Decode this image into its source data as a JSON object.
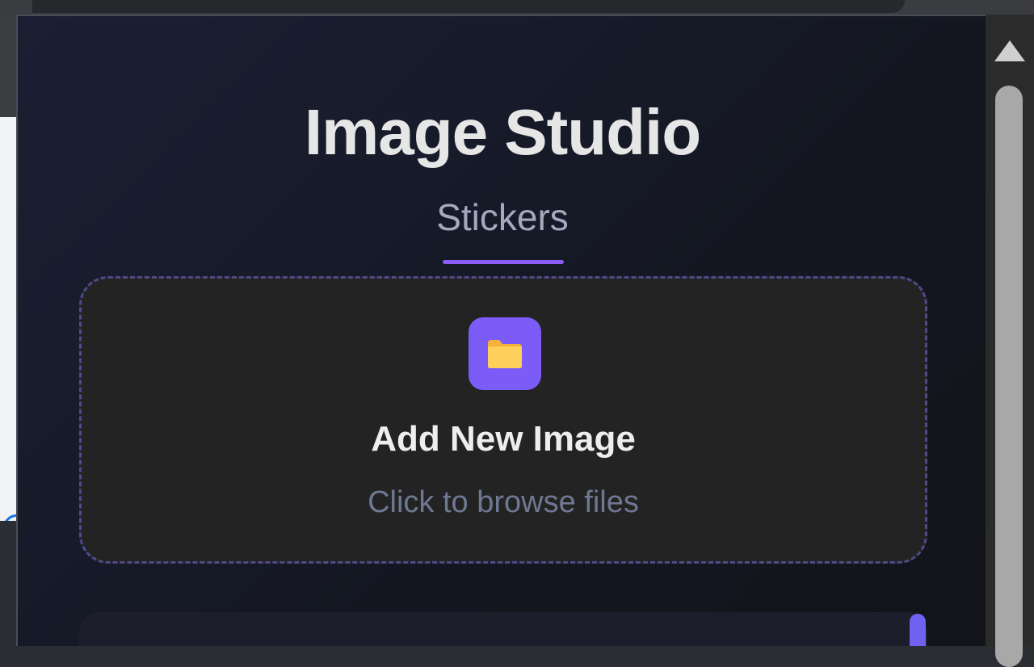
{
  "header": {
    "title": "Image Studio",
    "subtitle": "Stickers"
  },
  "upload": {
    "label": "Add New Image",
    "hint": "Click to browse files",
    "icon": "folder-icon"
  },
  "colors": {
    "accent": "#8b5cf6",
    "icon_tile": "#7c5cf6",
    "folder": "#ffc94d",
    "background": "#141722"
  }
}
